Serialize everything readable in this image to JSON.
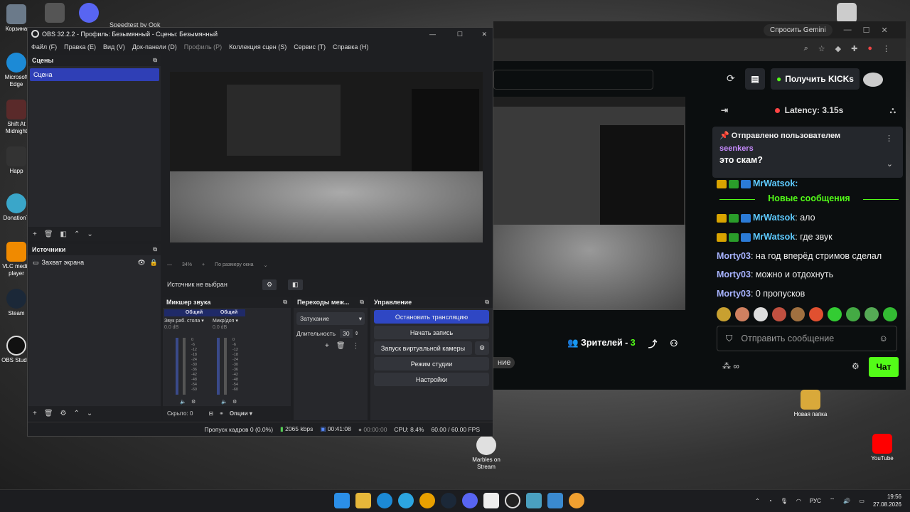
{
  "desktop": {
    "icons": [
      {
        "label": "Корзина"
      },
      {
        "label": "Microsoft Edge"
      },
      {
        "label": "Shift At Midnight"
      },
      {
        "label": "Happ"
      },
      {
        "label": "DonationT"
      },
      {
        "label": "VLC media player"
      },
      {
        "label": "Steam"
      },
      {
        "label": "OBS Studio"
      }
    ],
    "right_icons": [
      {
        "label": "Новая папка"
      },
      {
        "label": "YouTube"
      }
    ],
    "center_icon": {
      "label": "Marbles on Stream"
    },
    "top_label": "Speedtest by Ook"
  },
  "browser": {
    "gemini": "Спросить Gemini",
    "get_kicks": "Получить KICKs",
    "latency": "Latency: 3.15s",
    "pinned_header": "Отправлено пользователем",
    "pinned_user": "seenkers",
    "pinned_text": "это скам?",
    "pinned_partial_user": "MrWatsok:",
    "new_messages": "Новые сообщения",
    "messages": [
      {
        "user": "MrWatsok",
        "text": ": ало",
        "color": "#5ecbff"
      },
      {
        "user": "MrWatsok",
        "text": ": где звук",
        "color": "#5ecbff"
      },
      {
        "user": "Morty03",
        "text": ": на год вперёд стримов сделал",
        "color": "#a7b3ff"
      },
      {
        "user": "Morty03",
        "text": ": можно и отдохнуть",
        "color": "#a7b3ff"
      },
      {
        "user": "Morty03",
        "text": ": 0 пропусков",
        "color": "#a7b3ff"
      }
    ],
    "send_placeholder": "Отправить сообщение",
    "chat_button": "Чат",
    "viewers_label": "Зрителей - ",
    "viewers_count": "3",
    "obscured": "ние"
  },
  "obs": {
    "title": "OBS 32.2.2 - Профиль: Безымянный - Сцены: Безымянный",
    "menu": [
      "Файл (F)",
      "Правка (E)",
      "Вид (V)",
      "Док-панели (D)",
      "Профиль (P)",
      "Коллекция сцен (S)",
      "Сервис (T)",
      "Справка (H)"
    ],
    "scenes_title": "Сцены",
    "scene_item": "Сцена",
    "sources_title": "Источники",
    "source_item": "Захват экрана",
    "zoom": "34%",
    "fit": "По размеру окна",
    "no_source": "Источник не выбран",
    "mixer_title": "Микшер звука",
    "transitions_title": "Переходы меж...",
    "controls_title": "Управление",
    "ch1_head": "Общий",
    "ch1_name": "Звук раб. стола",
    "ch1_db": "0.0 dB",
    "ch2_head": "Общий",
    "ch2_name": "Микр/доп",
    "ch2_db": "0.0 dB",
    "scale": [
      "0",
      "-6",
      "-12",
      "-18",
      "-24",
      "-30",
      "-36",
      "-42",
      "-48",
      "-54",
      "-60"
    ],
    "hidden": "Скрыто: 0",
    "options": "Опции",
    "transition": "Затухание",
    "duration_label": "Длительность",
    "duration": "30",
    "btn_stop_stream": "Остановить трансляцию",
    "btn_record": "Начать запись",
    "btn_vcam": "Запуск виртуальной камеры",
    "btn_studio": "Режим студии",
    "btn_settings": "Настройки",
    "status_drop": "Пропуск кадров 0 (0.0%)",
    "status_kbps": "2065 kbps",
    "status_time": "00:41:08",
    "status_rec": "00:00:00",
    "status_cpu": "CPU: 8.4%",
    "status_fps": "60.00 / 60.00 FPS"
  },
  "taskbar": {
    "lang": "РУС",
    "time": "19:56",
    "date": "27.08.2026"
  }
}
